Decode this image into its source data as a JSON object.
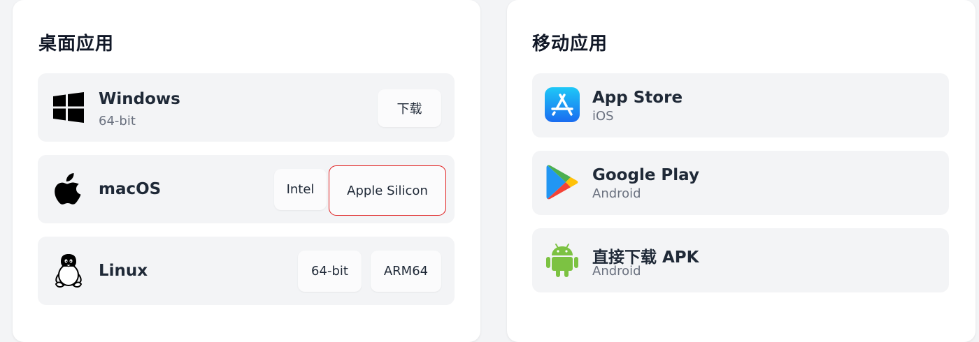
{
  "desktop": {
    "title": "桌面应用",
    "windows": {
      "name": "Windows",
      "sub": "64-bit",
      "button": "下载"
    },
    "macos": {
      "name": "macOS",
      "buttons": [
        "Intel",
        "Apple Silicon"
      ]
    },
    "linux": {
      "name": "Linux",
      "buttons": [
        "64-bit",
        "ARM64"
      ]
    }
  },
  "mobile": {
    "title": "移动应用",
    "items": [
      {
        "name": "App Store",
        "sub": "iOS",
        "icon": "app-store-icon"
      },
      {
        "name": "Google Play",
        "sub": "Android",
        "icon": "google-play-icon"
      },
      {
        "name": "直接下载 APK",
        "sub": "Android",
        "icon": "android-icon"
      }
    ]
  },
  "colors": {
    "highlight": "#e11d1d",
    "app_store_blue": "#1a8cf5",
    "android_green": "#7cc242"
  }
}
